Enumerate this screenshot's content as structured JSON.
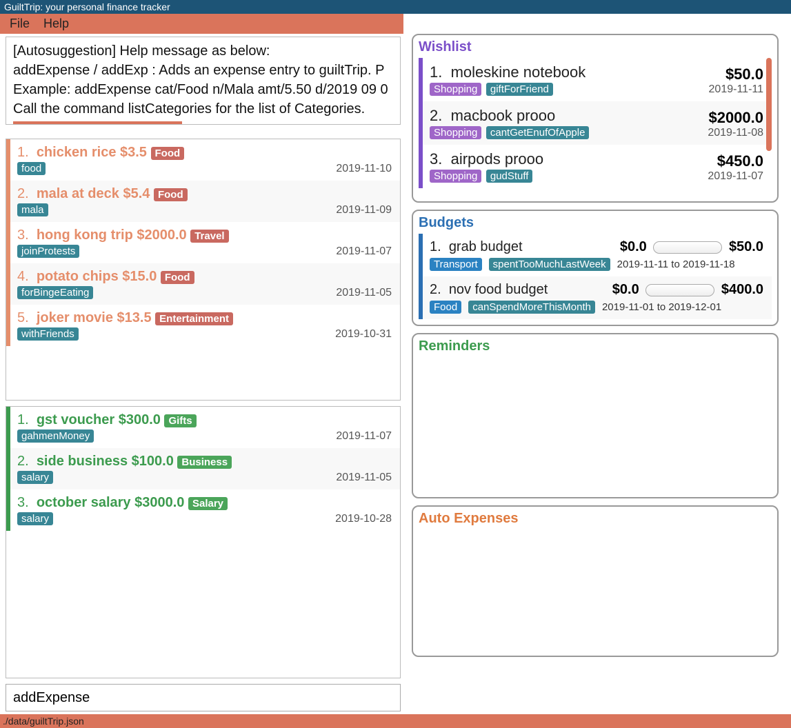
{
  "window": {
    "title": "GuiltTrip: your personal finance tracker"
  },
  "menu": {
    "file": "File",
    "help": "Help"
  },
  "helpbox": {
    "line1": "[Autosuggestion] Help message as below:",
    "line2": "addExpense / addExp : Adds an expense entry to guiltTrip. P",
    "line3": "Example: addExpense cat/Food n/Mala amt/5.50 d/2019 09 0",
    "line4": "Call the command listCategories for the list of Categories."
  },
  "expenses": [
    {
      "idx": "1.",
      "name": "chicken rice",
      "amount": "$3.5",
      "category": "Food",
      "tag": "food",
      "date": "2019-11-10"
    },
    {
      "idx": "2.",
      "name": "mala at deck",
      "amount": "$5.4",
      "category": "Food",
      "tag": "mala",
      "date": "2019-11-09"
    },
    {
      "idx": "3.",
      "name": "hong kong trip",
      "amount": "$2000.0",
      "category": "Travel",
      "tag": "joinProtests",
      "date": "2019-11-07"
    },
    {
      "idx": "4.",
      "name": "potato chips",
      "amount": "$15.0",
      "category": "Food",
      "tag": "forBingeEating",
      "date": "2019-11-05"
    },
    {
      "idx": "5.",
      "name": "joker movie",
      "amount": "$13.5",
      "category": "Entertainment",
      "tag": "withFriends",
      "date": "2019-10-31"
    }
  ],
  "income": [
    {
      "idx": "1.",
      "name": "gst voucher",
      "amount": "$300.0",
      "category": "Gifts",
      "tag": "gahmenMoney",
      "date": "2019-11-07"
    },
    {
      "idx": "2.",
      "name": "side business",
      "amount": "$100.0",
      "category": "Business",
      "tag": "salary",
      "date": "2019-11-05"
    },
    {
      "idx": "3.",
      "name": "october salary",
      "amount": "$3000.0",
      "category": "Salary",
      "tag": "salary",
      "date": "2019-10-28"
    }
  ],
  "wishlist": {
    "title": "Wishlist",
    "items": [
      {
        "idx": "1.",
        "name": "moleskine notebook",
        "category": "Shopping",
        "tag": "giftForFriend",
        "price": "$50.0",
        "date": "2019-11-11"
      },
      {
        "idx": "2.",
        "name": "macbook prooo",
        "category": "Shopping",
        "tag": "cantGetEnufOfApple",
        "price": "$2000.0",
        "date": "2019-11-08"
      },
      {
        "idx": "3.",
        "name": "airpods prooo",
        "category": "Shopping",
        "tag": "gudStuff",
        "price": "$450.0",
        "date": "2019-11-07"
      }
    ]
  },
  "budgets": {
    "title": "Budgets",
    "items": [
      {
        "idx": "1.",
        "name": "grab budget",
        "spent": "$0.0",
        "total": "$50.0",
        "category": "Transport",
        "tag": "spentTooMuchLastWeek",
        "range": "2019-11-11 to 2019-11-18"
      },
      {
        "idx": "2.",
        "name": "nov food budget",
        "spent": "$0.0",
        "total": "$400.0",
        "category": "Food",
        "tag": "canSpendMoreThisMonth",
        "range": "2019-11-01 to 2019-12-01"
      }
    ]
  },
  "reminders": {
    "title": "Reminders"
  },
  "autoexp": {
    "title": "Auto Expenses"
  },
  "command": {
    "value": "addExpense"
  },
  "status": {
    "path": "./data/guiltTrip.json"
  }
}
